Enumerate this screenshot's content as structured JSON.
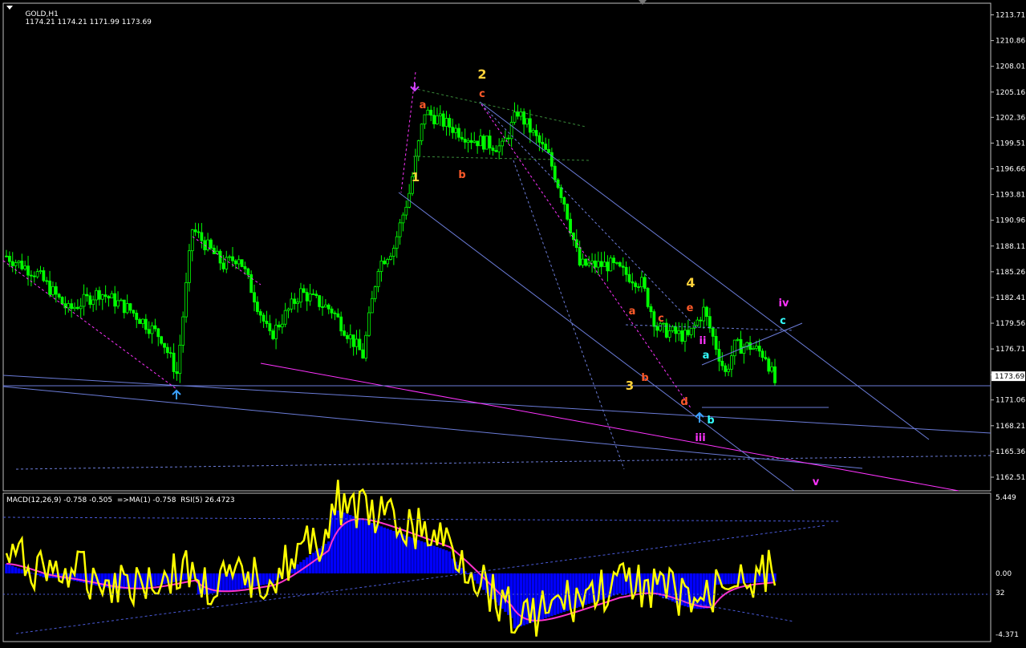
{
  "header": {
    "symbol": "GOLD,H1",
    "ohlc": "1174.21 1174.21 1171.99 1173.69",
    "dropdown_icon": "triangle-down-icon"
  },
  "macd_header": {
    "text": "MACD(12,26,9) -0.758 -0.505  =>MA(1) -0.758  RSI(5) 26.4723"
  },
  "colors": {
    "background": "#000000",
    "frame": "#c0c0c0",
    "bull_candle": "#00ff00",
    "bear_candle": "#00ff00",
    "current_price_line": "#6b7cd8",
    "macd_hist": "#0000ff",
    "macd_signal": "#ff33cc",
    "rsi": "#ffff00"
  },
  "wave_labels": [
    {
      "text": "1",
      "color": "#ffd23a"
    },
    {
      "text": "2",
      "color": "#ffd23a"
    },
    {
      "text": "3",
      "color": "#ffd23a"
    },
    {
      "text": "4",
      "color": "#ffd23a"
    },
    {
      "text": "a",
      "color": "#ff5a2a"
    },
    {
      "text": "b",
      "color": "#ff5a2a"
    },
    {
      "text": "c",
      "color": "#ff5a2a"
    },
    {
      "text": "a",
      "color": "#ff5a2a"
    },
    {
      "text": "b",
      "color": "#ff5a2a"
    },
    {
      "text": "c",
      "color": "#ff5a2a"
    },
    {
      "text": "d",
      "color": "#ff5a2a"
    },
    {
      "text": "e",
      "color": "#ff5a2a"
    },
    {
      "text": "ii",
      "color": "#ff33ff"
    },
    {
      "text": "iii",
      "color": "#ff33ff"
    },
    {
      "text": "iv",
      "color": "#ff33ff"
    },
    {
      "text": "v",
      "color": "#ff33ff"
    },
    {
      "text": "a",
      "color": "#33ffff"
    },
    {
      "text": "b",
      "color": "#33ffff"
    },
    {
      "text": "c",
      "color": "#33ffff"
    }
  ],
  "chart_data": [
    {
      "type": "candlestick",
      "title": "GOLD,H1",
      "ylim": [
        1161.0,
        1215.0
      ],
      "y_ticks": [
        "1213.71",
        "1210.86",
        "1208.01",
        "1205.16",
        "1202.36",
        "1199.51",
        "1196.66",
        "1193.81",
        "1190.96",
        "1188.11",
        "1185.26",
        "1182.41",
        "1179.56",
        "1176.71",
        "1173.86",
        "1171.06",
        "1168.21",
        "1165.36",
        "1162.51"
      ],
      "current_price": "1173.69",
      "grid": false,
      "bars": 240,
      "approx_close_path": [
        [
          0,
          1187
        ],
        [
          10,
          1185
        ],
        [
          20,
          1181
        ],
        [
          30,
          1183
        ],
        [
          40,
          1181
        ],
        [
          50,
          1178
        ],
        [
          55,
          1174
        ],
        [
          60,
          1190
        ],
        [
          70,
          1186
        ],
        [
          75,
          1187
        ],
        [
          85,
          1178
        ],
        [
          95,
          1183
        ],
        [
          105,
          1181
        ],
        [
          115,
          1176
        ],
        [
          120,
          1186
        ],
        [
          125,
          1188
        ],
        [
          130,
          1194
        ],
        [
          135,
          1203
        ],
        [
          140,
          1202
        ],
        [
          150,
          1200
        ],
        [
          160,
          1199
        ],
        [
          165,
          1203
        ],
        [
          175,
          1198
        ],
        [
          180,
          1193
        ],
        [
          185,
          1186
        ],
        [
          195,
          1186
        ],
        [
          205,
          1184
        ],
        [
          210,
          1179
        ],
        [
          220,
          1178
        ],
        [
          225,
          1181
        ],
        [
          230,
          1176
        ],
        [
          232,
          1174
        ],
        [
          235,
          1177
        ],
        [
          240,
          1177
        ],
        [
          245,
          1176
        ],
        [
          248,
          1173
        ]
      ]
    },
    {
      "type": "line",
      "title": "MACD(12,26,9) -0.758 -0.505  =>MA(1) -0.758  RSI(5) 26.4723",
      "ylim": [
        -4.371,
        5.449
      ],
      "y_ticks": [
        "5.449",
        "0.00",
        "32",
        "-4.371"
      ],
      "series": [
        {
          "name": "MACD",
          "style": "histogram"
        },
        {
          "name": "Signal",
          "style": "line"
        },
        {
          "name": "RSI(5)",
          "style": "line"
        }
      ]
    }
  ]
}
